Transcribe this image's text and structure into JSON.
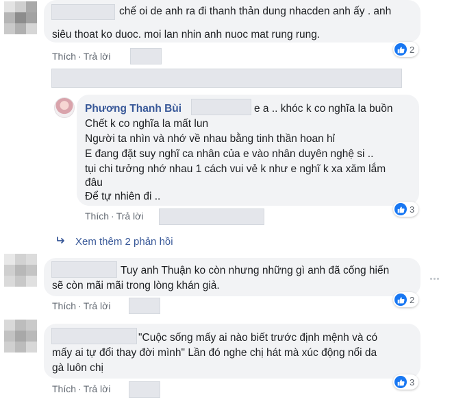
{
  "actions": {
    "like": "Thích",
    "reply": "Trả lời",
    "separator": "·"
  },
  "comments": [
    {
      "lines": [
        "chế oi de anh ra đi thanh thản dung nhacden anh ấy . anh",
        "siêu thoat ko duoc. moi lan nhin anh nuoc mat rung rung."
      ],
      "reactions": "2"
    },
    {
      "author": "Phương Thanh Bùi",
      "first_line_suffix": "e a .. khóc k co nghĩa la buồn",
      "lines": [
        "Chết k co nghĩa la mất lun",
        "Người ta nhìn và nhớ về nhau bằng tinh thần hoan hỉ",
        "E đang đặt suy nghĩ ca nhân của e vào nhân duyên nghệ si ..",
        "tụi chi tưởng nhớ nhau 1 cách vui vẻ k như e nghĩ k xa xăm lắm",
        "đâu",
        "Để tự nhiên đi .."
      ],
      "reactions": "3"
    },
    {
      "lines": [
        "Tuy anh Thuận ko còn nhưng những gì anh đã cống hiến",
        "sẽ còn mãi mãi trong lòng khán giả."
      ],
      "reactions": "2"
    },
    {
      "lines": [
        "\"Cuộc sống mấy ai nào biết trước định mệnh và có",
        "mấy ai tự đổi thay đời mình\" Lần đó nghe chị hát mà xúc động nổi da",
        "gà luôn chị"
      ],
      "reactions": "3"
    }
  ],
  "more_replies": "Xem thêm 2 phản hồi",
  "icons": {
    "like": "thumbs-up-icon",
    "more_replies": "reply-arrow-icon",
    "options": "more-options-icon"
  },
  "colors": {
    "bubble": "#f2f3f5",
    "name": "#385898",
    "link": "#385898",
    "action": "#606770",
    "like": "#1877f2"
  }
}
